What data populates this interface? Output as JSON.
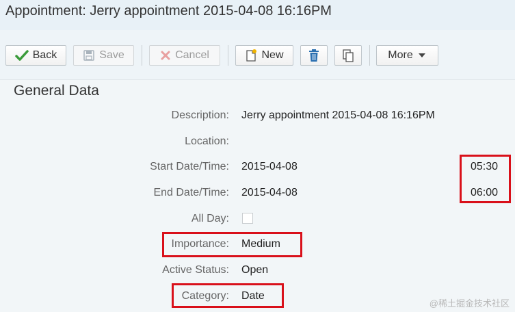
{
  "window": {
    "title": "Appointment: Jerry appointment 2015-04-08 16:16PM"
  },
  "toolbar": {
    "back_label": "Back",
    "save_label": "Save",
    "cancel_label": "Cancel",
    "new_label": "New",
    "more_label": "More",
    "icons": {
      "back": "checkmark-icon",
      "save": "floppy-disk-icon",
      "cancel": "x-icon",
      "new": "new-document-icon",
      "delete": "trash-icon",
      "copy": "copy-icon",
      "more": "dropdown-arrow-icon"
    }
  },
  "section": {
    "title": "General Data"
  },
  "fields": {
    "description": {
      "label": "Description:",
      "value": "Jerry appointment 2015-04-08 16:16PM"
    },
    "location": {
      "label": "Location:",
      "value": ""
    },
    "start": {
      "label": "Start Date/Time:",
      "date": "2015-04-08",
      "time": "05:30"
    },
    "end": {
      "label": "End Date/Time:",
      "date": "2015-04-08",
      "time": "06:00"
    },
    "all_day": {
      "label": "All Day:",
      "checked": false
    },
    "importance": {
      "label": "Importance:",
      "value": "Medium"
    },
    "active_status": {
      "label": "Active Status:",
      "value": "Open"
    },
    "category": {
      "label": "Category:",
      "value": "Date"
    }
  },
  "colors": {
    "highlight": "#d9101a",
    "back_check": "#3a9b3a",
    "cancel_x": "#e05a5a",
    "trash": "#2a6fb0",
    "new_star": "#f0b400"
  },
  "watermark": "@稀土掘金技术社区"
}
